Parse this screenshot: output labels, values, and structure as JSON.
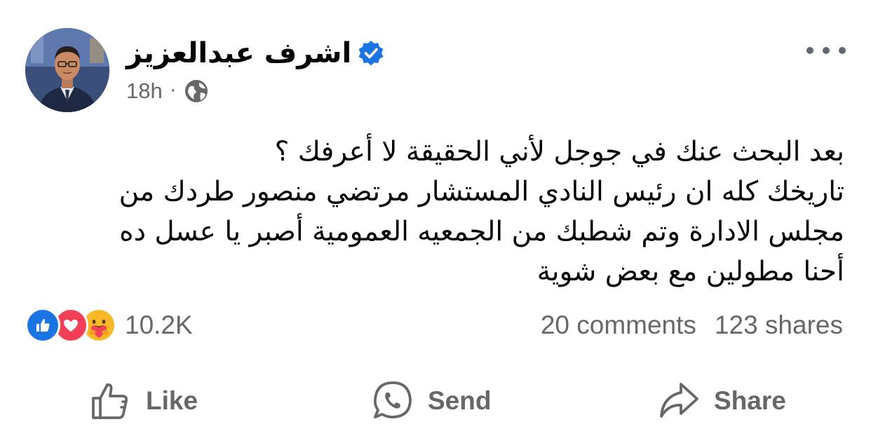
{
  "author": {
    "name": "اشرف عبدالعزيز",
    "verified": true,
    "timestamp": "18h",
    "separator": "·",
    "audience_icon": "globe-icon"
  },
  "menu": {
    "icon": "more-options-icon"
  },
  "post": {
    "lines": [
      "بعد البحث عنك في جوجل لأني الحقيقة لا أعرفك ؟",
      "تاريخك كله ان رئيس النادي المستشار مرتضي منصور طردك من",
      "مجلس الادارة وتم شطبك من الجمعيه العمومية أصبر يا عسل ده",
      "أحنا مطولين مع بعض شوية"
    ]
  },
  "reactions": {
    "icons": [
      "like-reaction-icon",
      "love-reaction-icon",
      "care-reaction-icon"
    ],
    "count": "10.2K"
  },
  "stats": {
    "comments": "20 comments",
    "shares": "123 shares"
  },
  "actions": {
    "like_label": "Like",
    "send_label": "Send",
    "share_label": "Share"
  },
  "colors": {
    "verified": "#1b74e4",
    "like": "#1b74e4",
    "love": "#f33e58",
    "care": "#f7b928",
    "secondary_text": "#65676b"
  }
}
